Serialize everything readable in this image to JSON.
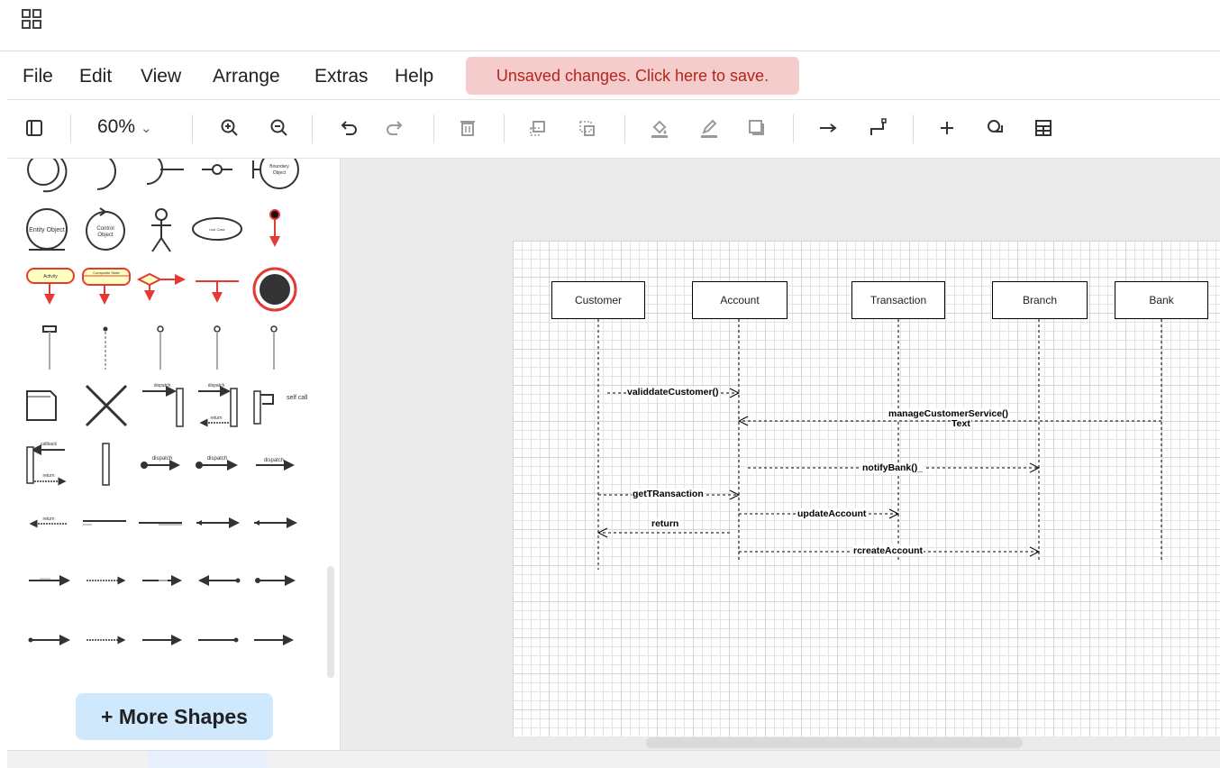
{
  "menu": {
    "items": [
      "File",
      "Edit",
      "View",
      "Arrange",
      "Extras",
      "Help"
    ],
    "unsaved_banner": "Unsaved changes. Click here to save."
  },
  "toolbar": {
    "zoom": "60%",
    "icons": [
      "format-panel-icon",
      "zoom-in-icon",
      "zoom-out-icon",
      "undo-icon",
      "redo-icon",
      "delete-icon",
      "to-front-icon",
      "to-back-icon",
      "fill-color-icon",
      "line-color-icon",
      "shadow-icon",
      "connection-icon",
      "waypoints-icon",
      "insert-icon",
      "shapes-icon",
      "table-icon"
    ]
  },
  "sidebar": {
    "more_shapes": "+ More Shapes",
    "shape_labels": {
      "boundary_object": "Boundary Object",
      "entity_object": "Entity Object",
      "control_object": "Control Object",
      "use_case": "Use Case",
      "activity": "Activity",
      "composite_state": "Composite State",
      "dispatch": "dispatch",
      "return": "return",
      "self_call": "self call",
      "callback": "callback"
    }
  },
  "diagram": {
    "lifelines": [
      "Customer",
      "Account",
      "Transaction",
      "Branch",
      "Bank"
    ],
    "messages": [
      "validdateCustomer()",
      "manageCustomerService()",
      "Text",
      "notifyBank()_",
      "getTRansaction",
      "updateAccount",
      "return",
      "rcreateAccount"
    ]
  },
  "colors": {
    "unsaved_bg": "#f4cccc",
    "unsaved_text": "#b3261e",
    "more_shapes_bg": "#cfe8fc",
    "canvas_bg": "#ebebeb",
    "uml_red": "#e53935",
    "uml_yellow": "#ffffc0"
  }
}
